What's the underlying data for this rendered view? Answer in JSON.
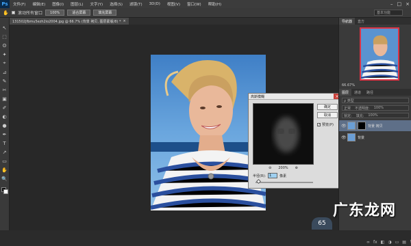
{
  "app": {
    "logo": "Ps"
  },
  "menu": [
    "文件(F)",
    "编辑(E)",
    "图像(I)",
    "图层(L)",
    "文字(Y)",
    "选择(S)",
    "滤镜(T)",
    "3D(D)",
    "视图(V)",
    "窗口(W)",
    "帮助(H)"
  ],
  "window_controls": {
    "minimize": "–",
    "maximize": "□",
    "close": "×"
  },
  "options": {
    "scroll_all": "滚动所有窗口",
    "zoom100": "100%",
    "fit_screen": "适合屏幕",
    "fill_screen": "填充屏幕",
    "workspace": "基本功能"
  },
  "doc_tab": {
    "title": "131502jfbmu5ezh2io2004.jpg @ 66.7% (背景 拷贝, 图层蒙版/8) *",
    "close": "×"
  },
  "tools": [
    "↖",
    "⬚",
    "ʘ",
    "✦",
    "⌖",
    "⊿",
    "✎",
    "✂",
    "▣",
    "✐",
    "◐",
    "●",
    "✒",
    "T",
    "↗",
    "▭",
    "✋",
    "🔍"
  ],
  "dialog": {
    "title": "高斯模糊",
    "close": "×",
    "ok": "确定",
    "cancel": "取消",
    "preview_label": "预览(P)",
    "preview_checked": "✓",
    "zoom_out": "⊖",
    "zoom_level": "200%",
    "zoom_in": "⊕",
    "radius_label": "半径(R):",
    "radius_value": "1",
    "radius_unit": "像素",
    "slider_value": 0.05
  },
  "panel": {
    "nav_tabs": [
      "导航器",
      "直方"
    ],
    "zoom": "66.67%",
    "layers_tabs": [
      "图层",
      "通道",
      "路径"
    ],
    "filter_label": "ρ 类型",
    "blend_mode": "正常",
    "opacity_label": "不透明度:",
    "opacity": "100%",
    "lock_label": "锁定:",
    "fill_label": "填充:",
    "fill": "100%",
    "layers": [
      {
        "name": "背景 拷贝",
        "selected": true
      },
      {
        "name": "背景",
        "selected": false
      }
    ],
    "footer": [
      "∞",
      "fx",
      "◧",
      "◑",
      "▭",
      "▤",
      "🗑"
    ]
  },
  "watermark": "广东龙网",
  "badge": "65"
}
